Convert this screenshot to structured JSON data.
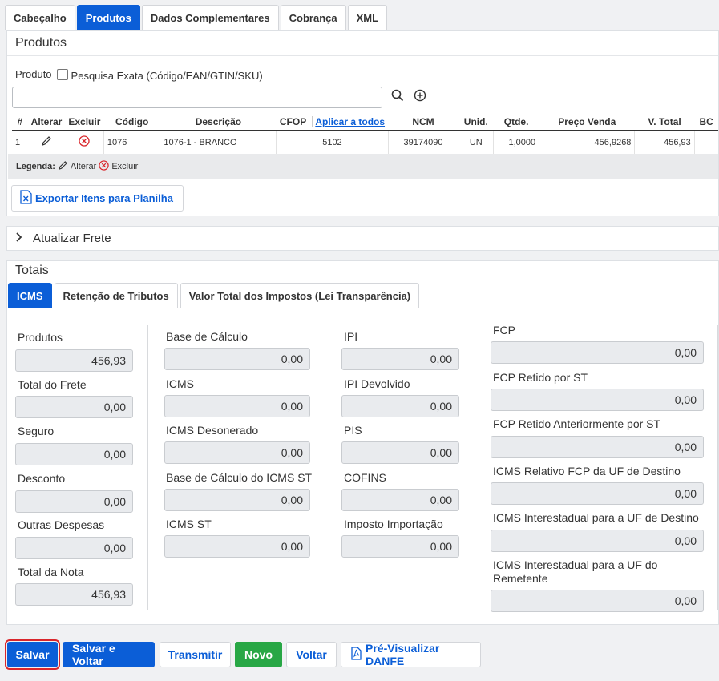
{
  "tabs": [
    "Cabeçalho",
    "Produtos",
    "Dados Complementares",
    "Cobrança",
    "XML"
  ],
  "produtos": {
    "title": "Produtos",
    "produto_label": "Produto",
    "pesquisa_exata": "Pesquisa Exata (Código/EAN/GTIN/SKU)",
    "search_value": "",
    "headers": [
      "#",
      "Alterar",
      "Excluir",
      "Código",
      "Descrição",
      "CFOP",
      "Aplicar a todos",
      "NCM",
      "Unid.",
      "Qtde.",
      "Preço Venda",
      "V. Total",
      "BC"
    ],
    "row": {
      "num": "1",
      "codigo": "1076",
      "descricao": "1076-1 - BRANCO",
      "cfop": "5102",
      "ncm": "39174090",
      "unid": "UN",
      "qtde": "1,0000",
      "preco": "456,9268",
      "vtotal": "456,93"
    },
    "legenda_label": "Legenda:",
    "legenda_alterar": "Alterar",
    "legenda_excluir": "Excluir",
    "export_label": "Exportar Itens para Planilha"
  },
  "frete": {
    "label": "Atualizar Frete"
  },
  "totais": {
    "title": "Totais",
    "tabs": [
      "ICMS",
      "Retenção de Tributos",
      "Valor Total dos Impostos (Lei Transparência)"
    ],
    "col1": [
      {
        "label": "Produtos",
        "value": "456,93"
      },
      {
        "label": "Total do Frete",
        "value": "0,00"
      },
      {
        "label": "Seguro",
        "value": "0,00"
      },
      {
        "label": "Desconto",
        "value": "0,00"
      },
      {
        "label": "Outras Despesas",
        "value": "0,00"
      },
      {
        "label": "Total da Nota",
        "value": "456,93"
      }
    ],
    "col2": [
      {
        "label": "Base de Cálculo",
        "value": "0,00"
      },
      {
        "label": "ICMS",
        "value": "0,00"
      },
      {
        "label": "ICMS Desonerado",
        "value": "0,00"
      },
      {
        "label": "Base de Cálculo do ICMS ST",
        "value": "0,00"
      },
      {
        "label": "ICMS ST",
        "value": "0,00"
      }
    ],
    "col3": [
      {
        "label": "IPI",
        "value": "0,00"
      },
      {
        "label": "IPI Devolvido",
        "value": "0,00"
      },
      {
        "label": "PIS",
        "value": "0,00"
      },
      {
        "label": "COFINS",
        "value": "0,00"
      },
      {
        "label": "Imposto Importação",
        "value": "0,00"
      }
    ],
    "col4": [
      {
        "label": "FCP",
        "value": "0,00"
      },
      {
        "label": "FCP Retido por ST",
        "value": "0,00"
      },
      {
        "label": "FCP Retido Anteriormente por ST",
        "value": "0,00"
      },
      {
        "label": "ICMS Relativo FCP da UF de Destino",
        "value": "0,00"
      },
      {
        "label": "ICMS Interestadual para a UF de Destino",
        "value": "0,00"
      },
      {
        "label": "ICMS Interestadual para a UF do",
        "label2": "Remetente",
        "value": "0,00"
      }
    ]
  },
  "actions": {
    "salvar": "Salvar",
    "salvar_voltar": "Salvar e Voltar",
    "transmitir": "Transmitir",
    "novo": "Novo",
    "voltar": "Voltar",
    "pre_visualizar": "Pré-Visualizar DANFE"
  }
}
